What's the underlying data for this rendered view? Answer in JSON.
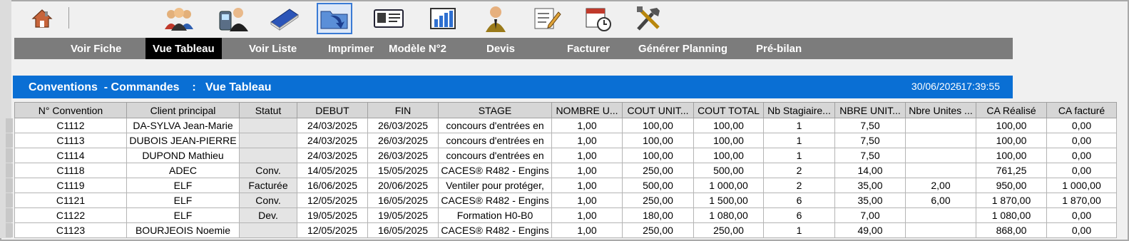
{
  "toolbar": {
    "icons": [
      "home-icon",
      "users-icon",
      "user-phone-icon",
      "book-icon",
      "folder-arrow-icon",
      "id-card-icon",
      "bar-chart-icon",
      "person-icon",
      "edit-form-icon",
      "calendar-clock-icon",
      "tools-icon"
    ]
  },
  "menu": {
    "voir_fiche": "Voir Fiche",
    "vue_tableau": "Vue Tableau",
    "voir_liste": "Voir Liste",
    "imprimer": "Imprimer",
    "modele": "Modèle N°2",
    "devis": "Devis",
    "facturer": "Facturer",
    "generer": "Générer Planning",
    "prebilan": "Pré-bilan"
  },
  "titlebar": {
    "title": "Conventions  - Commandes    :   Vue Tableau",
    "date": "30/06/2025",
    "time": "- 17:39:55"
  },
  "table": {
    "columns": [
      "N° Convention",
      "Client principal",
      "Statut",
      "DEBUT",
      "FIN",
      "STAGE",
      "NOMBRE U...",
      "COUT UNIT...",
      "COUT TOTAL",
      "Nb Stagiaire...",
      "NBRE UNIT...",
      "Nbre Unites ...",
      "CA Réalisé",
      "CA facturé"
    ],
    "rows": [
      [
        "C1112",
        "DA-SYLVA Jean-Marie",
        "",
        "24/03/2025",
        "26/03/2025",
        "concours d'entrées en",
        "1,00",
        "100,00",
        "100,00",
        "1",
        "7,50",
        "",
        "100,00",
        "0,00"
      ],
      [
        "C1113",
        "DUBOIS JEAN-PIERRE",
        "",
        "24/03/2025",
        "26/03/2025",
        "concours d'entrées en",
        "1,00",
        "100,00",
        "100,00",
        "1",
        "7,50",
        "",
        "100,00",
        "0,00"
      ],
      [
        "C1114",
        "DUPOND Mathieu",
        "",
        "24/03/2025",
        "26/03/2025",
        "concours d'entrées en",
        "1,00",
        "100,00",
        "100,00",
        "1",
        "7,50",
        "",
        "100,00",
        "0,00"
      ],
      [
        "C1118",
        "ADEC",
        "Conv.",
        "14/05/2025",
        "15/05/2025",
        "CACES® R482 - Engins",
        "1,00",
        "250,00",
        "500,00",
        "2",
        "14,00",
        "",
        "761,25",
        "0,00"
      ],
      [
        "C1119",
        "ELF",
        "Facturée",
        "16/06/2025",
        "20/06/2025",
        "Ventiler pour protéger,",
        "1,00",
        "500,00",
        "1 000,00",
        "2",
        "35,00",
        "2,00",
        "950,00",
        "1 000,00"
      ],
      [
        "C1121",
        "ELF",
        "Conv.",
        "12/05/2025",
        "16/05/2025",
        "CACES® R482 - Engins",
        "1,00",
        "250,00",
        "1 500,00",
        "6",
        "35,00",
        "6,00",
        "1 870,00",
        "1 870,00"
      ],
      [
        "C1122",
        "ELF",
        "Dev.",
        "19/05/2025",
        "19/05/2025",
        "Formation H0-B0",
        "1,00",
        "180,00",
        "1 080,00",
        "6",
        "7,00",
        "",
        "1 080,00",
        "0,00"
      ],
      [
        "C1123",
        "BOURJEOIS Noemie",
        "",
        "12/05/2025",
        "16/05/2025",
        "CACES® R482 - Engins",
        "1,00",
        "250,00",
        "250,00",
        "1",
        "49,00",
        "",
        "868,00",
        "0,00"
      ]
    ]
  }
}
